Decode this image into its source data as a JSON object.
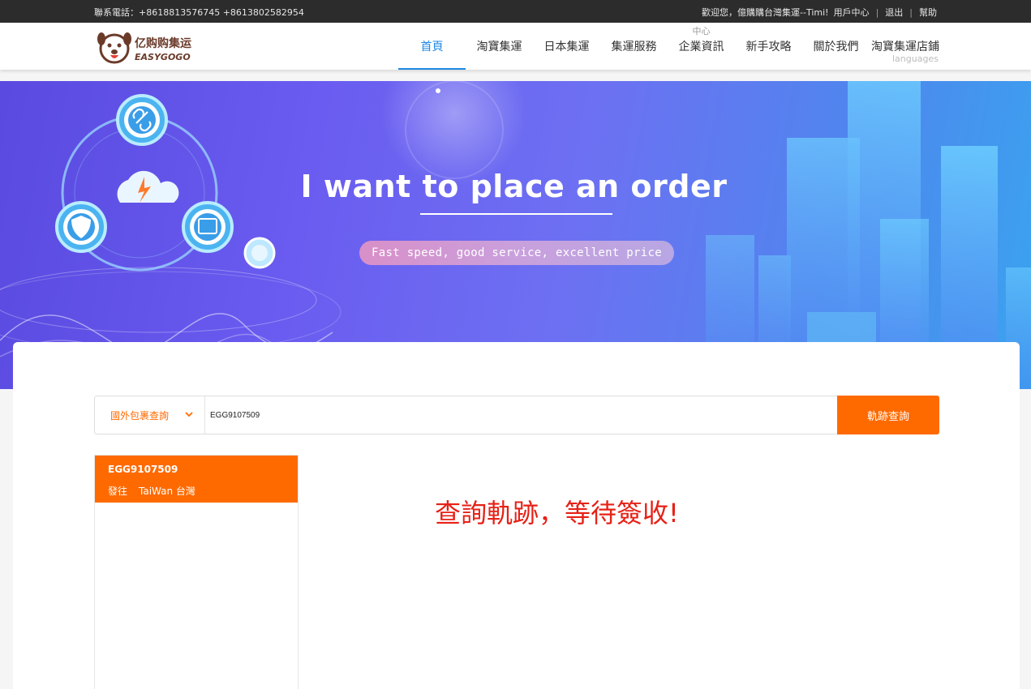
{
  "topbar": {
    "phone": "聯系電話：+8618813576745 +8613802582954",
    "welcome": "歡迎您，億購購台灣集運--Timi!",
    "user_center": "用戶中心",
    "logout": "退出",
    "help": "幫助"
  },
  "header": {
    "logo_text_cn": "亿购购集运",
    "logo_text_en": "EASYGOGO",
    "nav": [
      {
        "label": "首頁",
        "active": true
      },
      {
        "label": "淘寶集運"
      },
      {
        "label": "日本集運"
      },
      {
        "label": "集運服務"
      },
      {
        "label": "企業資訊",
        "overlay": "中心"
      },
      {
        "label": "新手攻略"
      },
      {
        "label": "關於我們"
      },
      {
        "label": "淘寶集運店鋪"
      }
    ],
    "languages": "languages"
  },
  "banner": {
    "title": "I want to place an order",
    "subtitle": "Fast speed, good service, excellent price"
  },
  "search": {
    "type": "國外包裹查詢",
    "value": "EGG9107509",
    "button": "軌跡查詢"
  },
  "result": {
    "code": "EGG9107509",
    "dest_label": "發往",
    "dest_value": "TaiWan 台灣",
    "message": "查詢軌跡，等待簽收!"
  },
  "colors": {
    "accent": "#ff6a00",
    "nav_active": "#1e88e5",
    "message": "#e62117"
  }
}
